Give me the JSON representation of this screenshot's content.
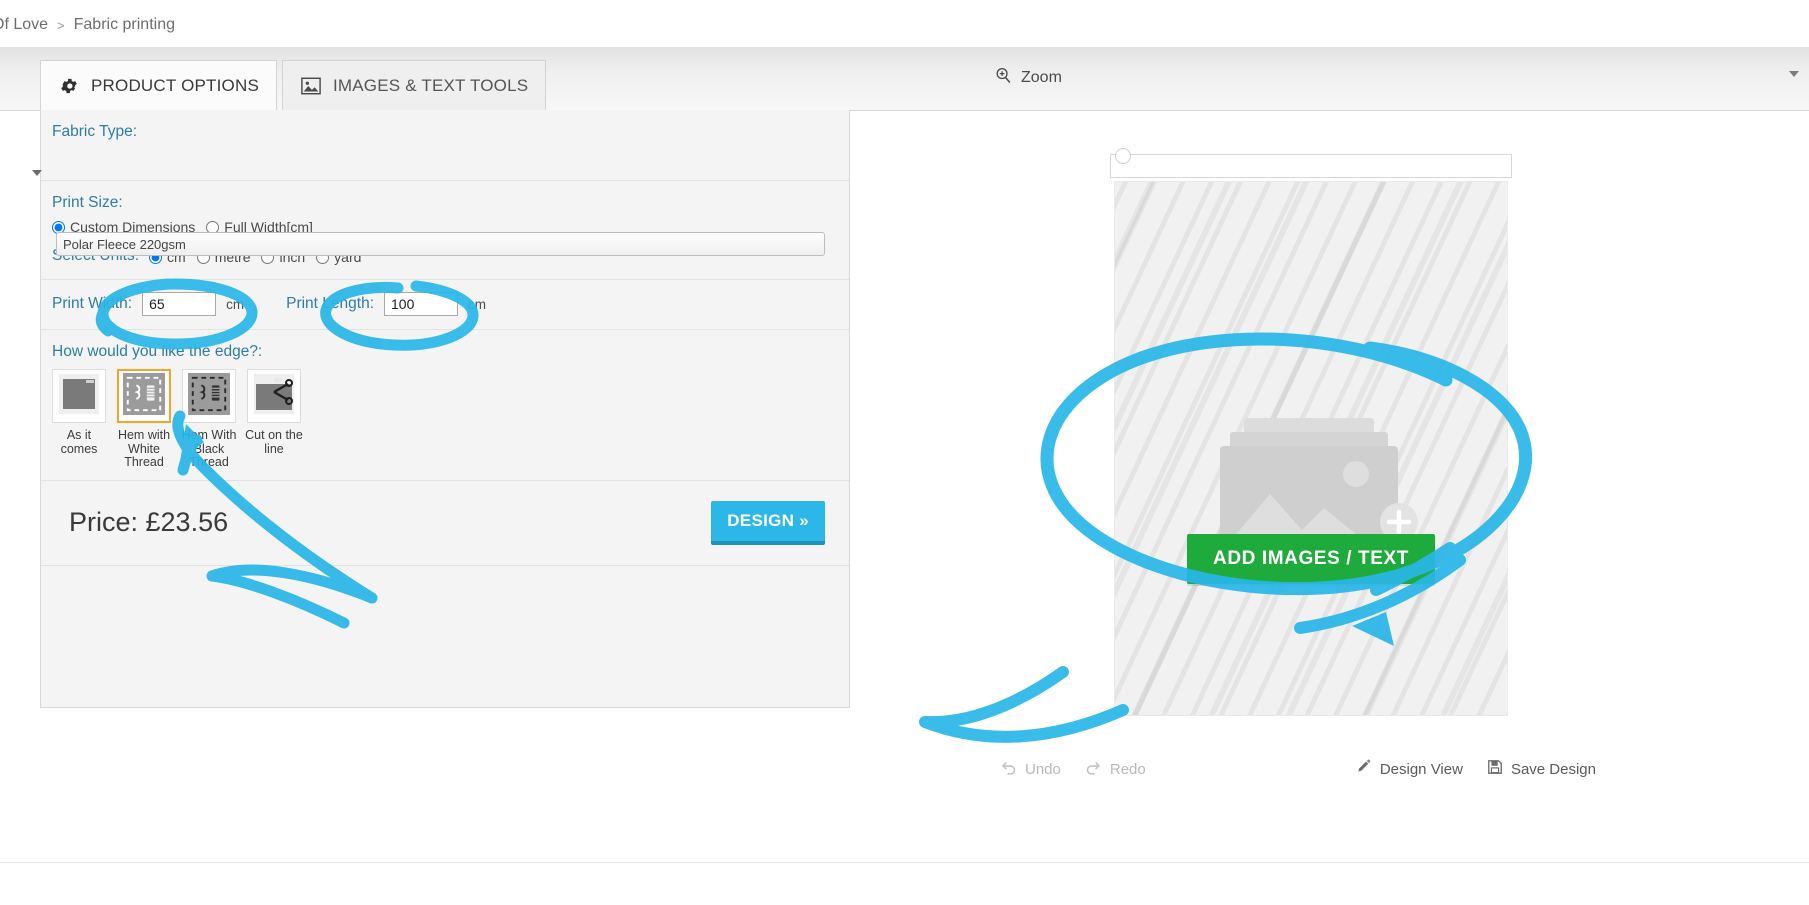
{
  "breadcrumb": {
    "items": [
      "Of Love",
      "Fabric printing"
    ],
    "separator": ">"
  },
  "tabs": [
    {
      "label": "PRODUCT OPTIONS",
      "icon": "gear-icon",
      "active": true
    },
    {
      "label": "IMAGES & TEXT TOOLS",
      "icon": "image-icon",
      "active": false
    }
  ],
  "zoom_control": {
    "label": "Zoom",
    "icon": "zoom-in-icon",
    "caret": "chevron-down-icon"
  },
  "fabric": {
    "label": "Fabric Type:",
    "selected": "Polar Fleece 220gsm",
    "options": [
      "Polar Fleece 220gsm"
    ]
  },
  "print_size": {
    "label": "Print Size:",
    "options": [
      {
        "label": "Custom Dimensions",
        "checked": true
      },
      {
        "label": "Full Width[cm]",
        "checked": false
      }
    ]
  },
  "units": {
    "label": "Select Units:",
    "options": [
      {
        "label": "cm",
        "checked": true
      },
      {
        "label": "metre",
        "checked": false
      },
      {
        "label": "inch",
        "checked": false
      },
      {
        "label": "yard",
        "checked": false
      }
    ]
  },
  "dimensions": {
    "width": {
      "label": "Print Width:",
      "value": "65",
      "unit": "cm"
    },
    "length": {
      "label": "Print Length:",
      "value": "100",
      "unit": "cm"
    }
  },
  "edge": {
    "label": "How would you like the edge?:",
    "options": [
      {
        "label": "As it comes",
        "icon": "plain-fabric-icon",
        "selected": false
      },
      {
        "label": "Hem with White Thread",
        "icon": "hem-white-thread-icon",
        "selected": true
      },
      {
        "label": "Hem With Black Thread",
        "icon": "hem-black-thread-icon",
        "selected": false
      },
      {
        "label": "Cut on the line",
        "icon": "scissors-icon",
        "selected": false
      }
    ]
  },
  "price": {
    "label": "Price: £23.56"
  },
  "design_button": {
    "label": "DESIGN »"
  },
  "preview": {
    "add_button": "ADD IMAGES / TEXT",
    "placeholder_icon": "image-placeholder-icon",
    "add_plus_icon": "plus-circle-icon"
  },
  "bottom_toolbar": [
    {
      "label": "Undo",
      "icon": "undo-icon",
      "enabled": false
    },
    {
      "label": "Redo",
      "icon": "redo-icon",
      "enabled": false
    },
    {
      "label": "Design View",
      "icon": "pencil-icon",
      "enabled": true
    },
    {
      "label": "Save Design",
      "icon": "floppy-disk-icon",
      "enabled": true
    }
  ],
  "colors": {
    "accent_blue": "#2e7da8",
    "design_button": "#2bb8e8",
    "add_button_green": "#1faa3c",
    "selected_thumb_border": "#f5a623",
    "annotation_blue": "#29b6e8"
  }
}
